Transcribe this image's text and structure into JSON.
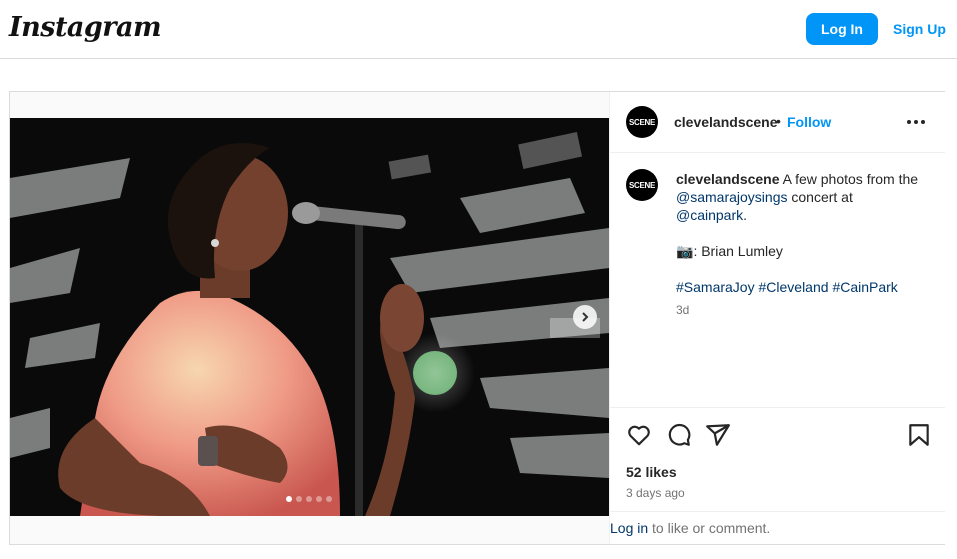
{
  "header": {
    "logo_text": "Instagram",
    "login_label": "Log In",
    "signup_label": "Sign Up"
  },
  "post": {
    "username": "clevelandscene",
    "avatar_text": "SCENE",
    "separator": "•",
    "follow_label": "Follow",
    "caption": {
      "username": "clevelandscene",
      "text1": " A few photos from the ",
      "mention1": "@samarajoysings",
      "text2": " concert at ",
      "mention2": "@cainpark",
      "text3": ".",
      "camera_emoji": "📷",
      "credit": ": Brian Lumley",
      "hashtag1": "#SamaraJoy",
      "hashtag2": "#Cleveland",
      "hashtag3": "#CainPark",
      "age": "3d"
    },
    "likes": "52 likes",
    "posted_ago": "3 days ago",
    "comment_prompt": {
      "login_link": "Log in",
      "rest": " to like or comment."
    },
    "carousel": {
      "slide_count": 5,
      "active_index": 0
    }
  },
  "colors": {
    "accent": "#0095f6",
    "link": "#00376b",
    "muted": "#737373",
    "border": "#dbdbdb"
  },
  "icons": [
    "heart-icon",
    "comment-icon",
    "share-icon",
    "bookmark-icon",
    "more-options-icon",
    "chevron-right-icon"
  ]
}
